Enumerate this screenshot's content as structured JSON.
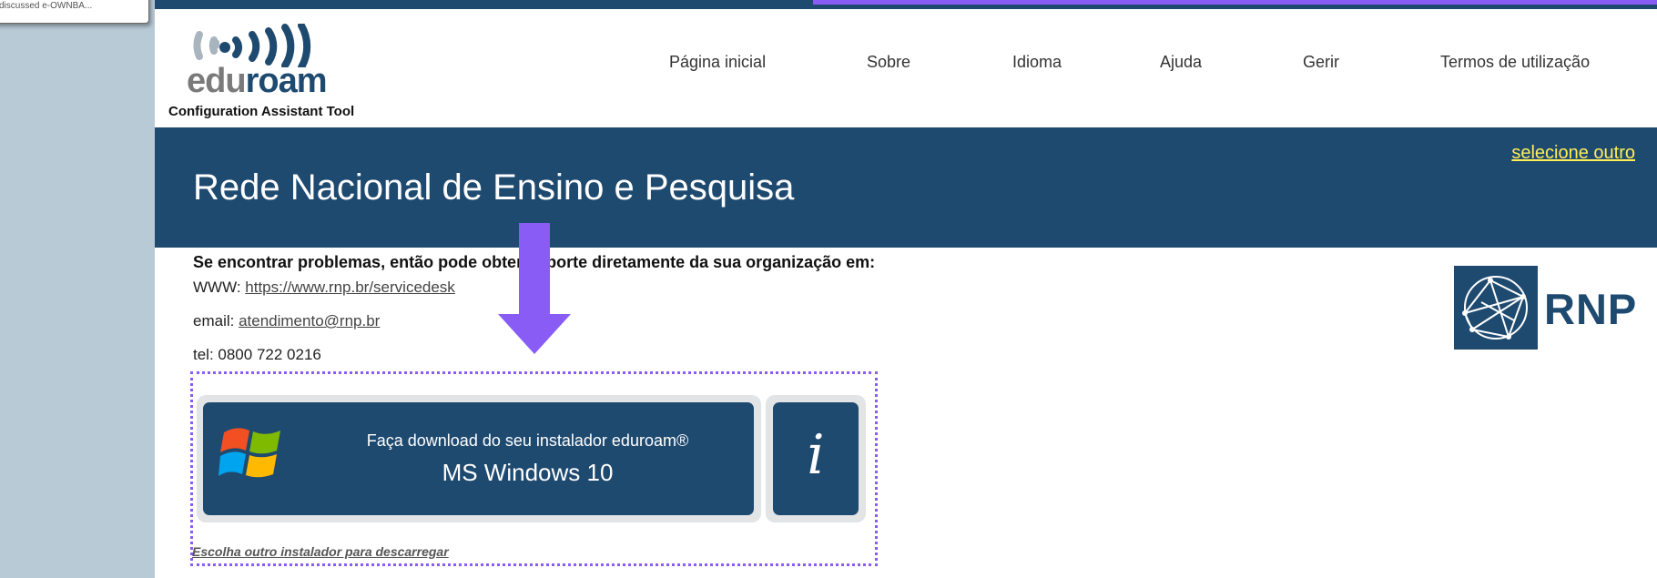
{
  "tooltip": {
    "text": "discussed e-OWNBA..."
  },
  "header": {
    "logo_text_edu": "edu",
    "logo_text_roam": "roam",
    "tool_caption": "Configuration Assistant Tool",
    "nav": [
      {
        "label": "Página inicial"
      },
      {
        "label": "Sobre"
      },
      {
        "label": "Idioma"
      },
      {
        "label": "Ajuda"
      },
      {
        "label": "Gerir"
      },
      {
        "label": "Termos de utilização"
      }
    ]
  },
  "banner": {
    "title": "Rede Nacional de Ensino e Pesquisa",
    "select_other": "selecione outro"
  },
  "support": {
    "heading": "Se encontrar problemas, então pode obter suporte diretamente da sua organização em:",
    "www_label": "WWW: ",
    "www_link": "https://www.rnp.br/servicedesk",
    "email_label": "email: ",
    "email_link": "atendimento@rnp.br",
    "tel": "tel: 0800 722 0216"
  },
  "org_logo": {
    "text": "RNP",
    "icon": "rnp-network-icon"
  },
  "download": {
    "line1": "Faça download do seu instalador eduroam®",
    "line2": "MS Windows 10",
    "os_icon": "windows-flag-icon",
    "info_icon": "info-icon",
    "info_glyph": "i",
    "other_installer": "Escolha outro instalador para descarregar"
  },
  "annotation": {
    "arrow_color": "#8a5cf6",
    "box_color": "#8a5cf6"
  },
  "colors": {
    "brand_blue": "#1f4a70",
    "link_yellow": "#ffee55",
    "panel_gray": "#e2e4e6"
  }
}
